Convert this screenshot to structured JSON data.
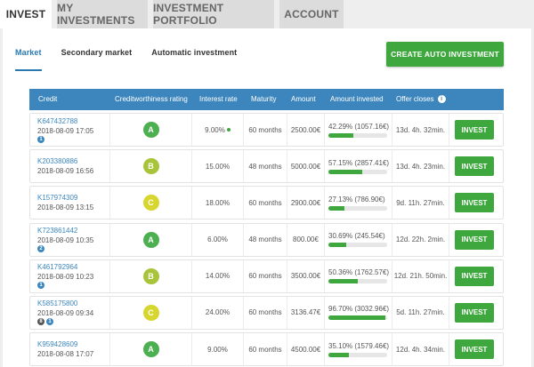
{
  "tabs": [
    "Invest",
    "My investments",
    "Investment portfolio",
    "Account"
  ],
  "subtabs": [
    "Market",
    "Secondary market",
    "Automatic investment"
  ],
  "cta_label": "Create auto investment",
  "columns": {
    "credit": "Credit",
    "rating": "Creditworthiness rating",
    "rate": "Interest rate",
    "maturity": "Maturity",
    "amount": "Amount",
    "invested": "Amount invested",
    "closes": "Offer closes"
  },
  "colors": {
    "accent": "#3c86bd",
    "green": "#3ea83e",
    "ratingA": "#4caf50",
    "ratingB": "#a8c43a",
    "ratingC": "#d6d62e"
  },
  "rows": [
    {
      "id": "K647432788",
      "date": "2018-08-09 17:05",
      "badges": [
        "1"
      ],
      "rating": "A",
      "rate": "9.00%",
      "rate_dot": true,
      "maturity": "60 months",
      "amount": "2500.00€",
      "invested": "42.29% (1057.16€)",
      "pct": 42.29,
      "closes": "13d. 4h. 32min.",
      "btn": "Invest"
    },
    {
      "id": "K203380886",
      "date": "2018-08-09 16:56",
      "badges": [],
      "rating": "B",
      "rate": "15.00%",
      "rate_dot": false,
      "maturity": "48 months",
      "amount": "5000.00€",
      "invested": "57.15% (2857.41€)",
      "pct": 57.15,
      "closes": "13d. 4h. 23min.",
      "btn": "Invest"
    },
    {
      "id": "K157974309",
      "date": "2018-08-09 13:15",
      "badges": [],
      "rating": "C",
      "rate": "18.00%",
      "rate_dot": false,
      "maturity": "60 months",
      "amount": "2900.00€",
      "invested": "27.13% (786.90€)",
      "pct": 27.13,
      "closes": "9d. 11h. 27min.",
      "btn": "Invest"
    },
    {
      "id": "K723861442",
      "date": "2018-08-09 10:35",
      "badges": [
        "2"
      ],
      "rating": "A",
      "rate": "6.00%",
      "rate_dot": false,
      "maturity": "48 months",
      "amount": "800.00€",
      "invested": "30.69% (245.54€)",
      "pct": 30.69,
      "closes": "12d. 22h. 2min.",
      "btn": "Invest"
    },
    {
      "id": "K461792964",
      "date": "2018-08-09 10:23",
      "badges": [
        "1"
      ],
      "rating": "B",
      "rate": "14.00%",
      "rate_dot": false,
      "maturity": "60 months",
      "amount": "3500.00€",
      "invested": "50.36% (1762.57€)",
      "pct": 50.36,
      "closes": "12d. 21h. 50min.",
      "btn": "Invest"
    },
    {
      "id": "K585175800",
      "date": "2018-08-09 09:34",
      "badges": [
        "8",
        "1"
      ],
      "rating": "C",
      "rate": "24.00%",
      "rate_dot": false,
      "maturity": "60 months",
      "amount": "3136.47€",
      "invested": "96.70% (3032.96€)",
      "pct": 96.7,
      "closes": "5d. 11h. 27min.",
      "btn": "Invest"
    },
    {
      "id": "K959428609",
      "date": "2018-08-08 17:07",
      "badges": [],
      "rating": "A",
      "rate": "9.00%",
      "rate_dot": false,
      "maturity": "60 months",
      "amount": "4500.00€",
      "invested": "35.10% (1579.46€)",
      "pct": 35.1,
      "closes": "12d. 4h. 34min.",
      "btn": "Invest"
    }
  ]
}
